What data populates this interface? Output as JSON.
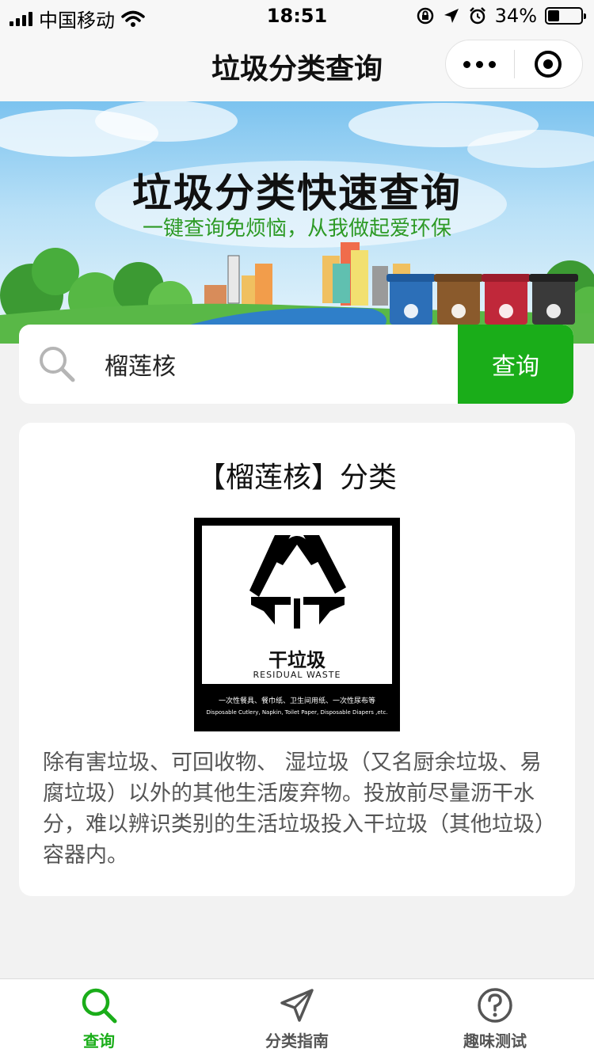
{
  "status_bar": {
    "carrier": "中国移动",
    "time": "18:51",
    "battery_text": "34%",
    "battery_level": 0.34
  },
  "nav": {
    "title": "垃圾分类查询",
    "more_icon": "more-dots-icon",
    "close_icon": "target-close-icon"
  },
  "banner": {
    "title": "垃圾分类快速查询",
    "subtitle": "一键查询免烦恼，从我做起爱环保"
  },
  "search": {
    "value": "榴莲核",
    "button_label": "查询",
    "icon": "search-icon"
  },
  "result": {
    "title": "【榴莲核】分类",
    "category_cn": "干垃圾",
    "category_en": "RESIDUAL WASTE",
    "examples_cn": "一次性餐具、餐巾纸、卫生间用纸、一次性尿布等",
    "examples_en": "Disposable Cutlery, Napkin, Toilet Paper, Disposable Diapers ,etc.",
    "description": "除有害垃圾、可回收物、 湿垃圾（又名厨余垃圾、易腐垃圾）以外的其他生活废弃物。投放前尽量沥干水分，难以辨识类别的生活垃圾投入干垃圾（其他垃圾）容器内。"
  },
  "tabs": [
    {
      "label": "查询",
      "icon": "search-icon",
      "active": true
    },
    {
      "label": "分类指南",
      "icon": "navigation-arrow-icon",
      "active": false
    },
    {
      "label": "趣味测试",
      "icon": "question-circle-icon",
      "active": false
    }
  ],
  "colors": {
    "accent": "#1aad19",
    "background": "#f2f2f2"
  }
}
